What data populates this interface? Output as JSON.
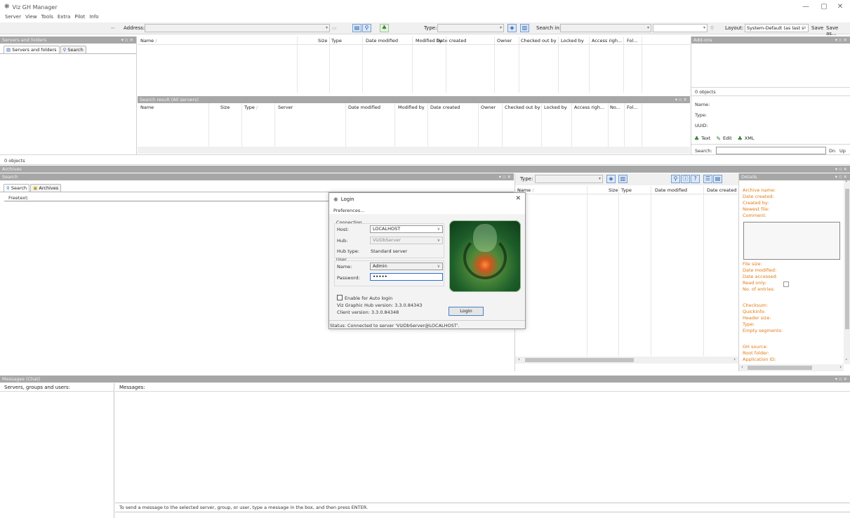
{
  "window": {
    "title": "Viz GH Manager",
    "app_icon": "snowflake-icon"
  },
  "menu": [
    "Server",
    "View",
    "Tools",
    "Extra",
    "Pilot",
    "Info"
  ],
  "toolbar": {
    "address_label": "Address:",
    "type_label": "Type:",
    "search_in_label": "Search in:",
    "layout_label": "Layout:",
    "layout_value": "System-Default (as last s",
    "save_label": "Save",
    "save_as_label": "Save as..."
  },
  "servers_panel": {
    "title": "Servers and folders",
    "tabs": [
      "Servers and folders",
      "Search"
    ],
    "status": "0 objects"
  },
  "browser_list": {
    "columns": [
      "Name",
      "Size",
      "Type",
      "Date modified",
      "Modified by",
      "Date created",
      "Owner",
      "Checked out by",
      "Locked by",
      "Access righ...",
      "Fol..."
    ]
  },
  "search_result": {
    "title": "Search result (All servers)",
    "columns": [
      "Name",
      "Size",
      "Type",
      "Server",
      "Date modified",
      "Modified by",
      "Date created",
      "Owner",
      "Checked out by",
      "Locked by",
      "Access righ...",
      "No...",
      "Fol..."
    ]
  },
  "addons": {
    "title": "Add-ons",
    "count": "0 objects",
    "name_label": "Name:",
    "type_label": "Type:",
    "uuid_label": "UUID:",
    "tabs": [
      "Text",
      "Edit",
      "XML"
    ],
    "search_label": "Search:",
    "dn_label": "Dn",
    "up_label": "Up"
  },
  "archives": {
    "title": "Archives",
    "search_title": "Search",
    "tabs": [
      "Search",
      "Archives"
    ],
    "freetext_label": "Freetext:",
    "type_label": "Type:",
    "columns": [
      "Name",
      "Size",
      "Type",
      "Date modified",
      "Date created"
    ]
  },
  "details": {
    "title": "Details",
    "fields": [
      "Archive name:",
      "Date created:",
      "Created by:",
      "Newest file:",
      "Comment:"
    ],
    "fields2": [
      "File size:",
      "Date modified:",
      "Date accessed:",
      "Read only:",
      "No. of entries:"
    ],
    "fields3": [
      "Checksum:",
      "Quickinfo:",
      "Header size:",
      "Type:",
      "Empty segments:"
    ],
    "fields4": [
      "GH source:",
      "Root folder:",
      "Application ID:"
    ]
  },
  "login": {
    "title": "Login",
    "preferences": "Preferences...",
    "connection_group": "Connection",
    "host_label": "Host:",
    "host_value": "LOCALHOST",
    "hub_label": "Hub:",
    "hub_value": "VizDbServer",
    "hubtype_label": "Hub type:",
    "hubtype_value": "Standard server",
    "user_group": "User",
    "name_label": "Name:",
    "name_value": "Admin",
    "password_label": "Password:",
    "password_value": "•••••",
    "autologin_label": "Enable for Auto login",
    "hub_version": "Viz Graphic Hub version: 3.3.0.84343",
    "client_version": "Client version: 3.3.0.84348",
    "login_button": "Login",
    "status": "Status: Connected to server 'VizDbServer@LOCALHOST'."
  },
  "messages": {
    "title": "Messages (Chat)",
    "users_label": "Servers, groups and users:",
    "messages_label": "Messages:",
    "hint": "To send a message to the selected server, group, or user, type a message in the box, and then press ENTER."
  }
}
